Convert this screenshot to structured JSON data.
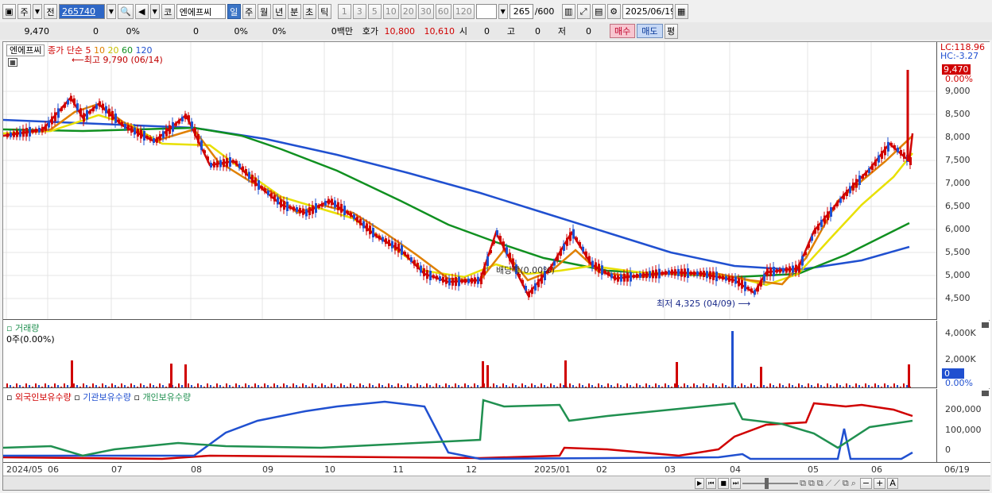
{
  "toolbar": {
    "market_label": "주",
    "prev_label": "전",
    "stock_code": "265740",
    "stock_name": "엔에프씨",
    "code_prefix": "코",
    "periods": [
      "일",
      "주",
      "월",
      "년",
      "분",
      "초",
      "틱"
    ],
    "selected_period": "일",
    "minute_values": [
      "1",
      "3",
      "5",
      "10",
      "20",
      "30",
      "60",
      "120"
    ],
    "count": "265",
    "count_total": "/600",
    "date": "2025/06/19"
  },
  "quote": {
    "price": "9,470",
    "change": "0",
    "change_pct": "0%",
    "volume": "0",
    "vol_pct": "0%",
    "vol_pct2": "0%",
    "amount": "0백만",
    "ask_label": "호가",
    "ask": "10,800",
    "bid": "10,610",
    "open_label": "시",
    "open": "0",
    "high_label": "고",
    "high": "0",
    "low_label": "저",
    "low": "0",
    "buy_label": "매수",
    "sell_label": "매도",
    "eval_label": "평"
  },
  "price_pane": {
    "title": "엔에프씨",
    "ma_label": "종가 단순",
    "ma_periods": [
      "5",
      "10",
      "20",
      "60",
      "120"
    ],
    "ma_colors": [
      "#d00000",
      "#e08000",
      "#e8e000",
      "#109020",
      "#2050d0"
    ],
    "high_note": "최고 9,790 (06/14)",
    "low_note": "최저 4,325 (04/09)",
    "dividend_note": "배당락(0.00%)",
    "lc_label": "LC:118.96",
    "hc_label": "HC:-3.27",
    "last_price": "9,470",
    "last_pct": "0.00%",
    "yticks": [
      "9,000",
      "8,500",
      "8,000",
      "7,500",
      "7,000",
      "6,500",
      "6,000",
      "5,500",
      "5,000",
      "4,500"
    ]
  },
  "volume_pane": {
    "title": "거래량",
    "current": "0주(0.00%)",
    "yticks": [
      "4,000K",
      "2,000K"
    ],
    "last_value": "0",
    "last_pct": "0.00%"
  },
  "holdings_pane": {
    "legend": [
      "외국인보유수량",
      "기관보유수량",
      "개인보유수량"
    ],
    "colors": [
      "#d00000",
      "#2050d0",
      "#209050"
    ],
    "yticks": [
      "200,000",
      "100,000",
      "0"
    ]
  },
  "x_axis": {
    "labels": [
      "2024/05",
      "06",
      "07",
      "08",
      "09",
      "10",
      "11",
      "12",
      "2025/01",
      "02",
      "03",
      "04",
      "05",
      "06",
      "06/19"
    ]
  }
}
